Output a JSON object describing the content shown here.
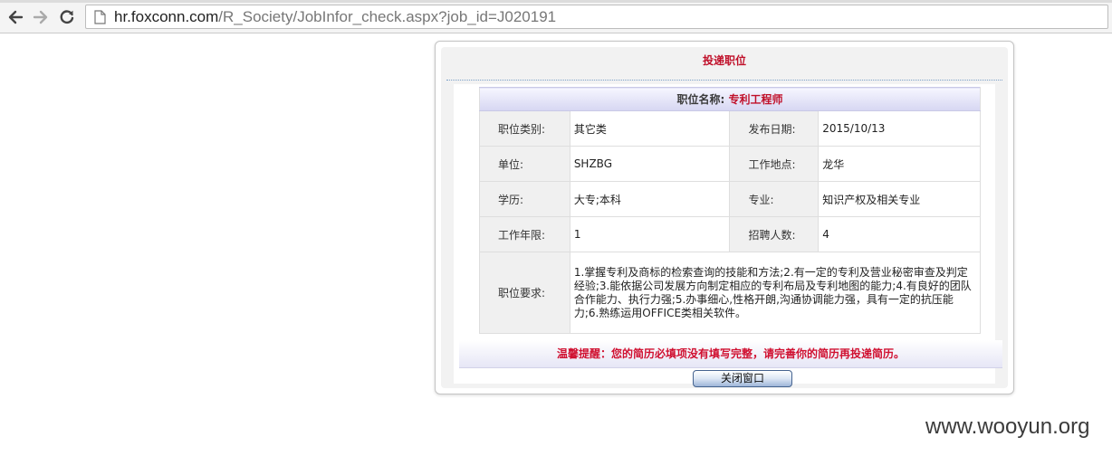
{
  "browser": {
    "url_host": "hr.foxconn.com",
    "url_path": "/R_Society/JobInfor_check.aspx?job_id=J020191"
  },
  "dialog": {
    "title": "投递职位",
    "job_header_label": "职位名称:",
    "job_name": "专利工程师",
    "fields": [
      {
        "label": "职位类别:",
        "value": "其它类"
      },
      {
        "label": "发布日期:",
        "value": "2015/10/13"
      },
      {
        "label": "单位:",
        "value": "SHZBG"
      },
      {
        "label": "工作地点:",
        "value": "龙华"
      },
      {
        "label": "学历:",
        "value": "大专;本科"
      },
      {
        "label": "专业:",
        "value": "知识产权及相关专业"
      },
      {
        "label": "工作年限:",
        "value": "1"
      },
      {
        "label": "招聘人数:",
        "value": "4"
      }
    ],
    "requirements_label": "职位要求:",
    "requirements_text": "1.掌握专利及商标的检索查询的技能和方法;2.有一定的专利及营业秘密审查及判定经验;3.能依据公司发展方向制定相应的专利布局及专利地图的能力;4.有良好的团队合作能力、执行力强;5.办事细心,性格开朗,沟通协调能力强，具有一定的抗压能力;6.熟练运用OFFICE类相关软件。",
    "warning": "温馨提醒：您的简历必填项没有填写完整，请完善你的简历再投递简历。",
    "close_button": "关闭窗口"
  },
  "watermark": "www.wooyun.org",
  "colors": {
    "title_red": "#c0102a",
    "warning_red": "#d01030",
    "header_band": "#d6d6f2"
  }
}
